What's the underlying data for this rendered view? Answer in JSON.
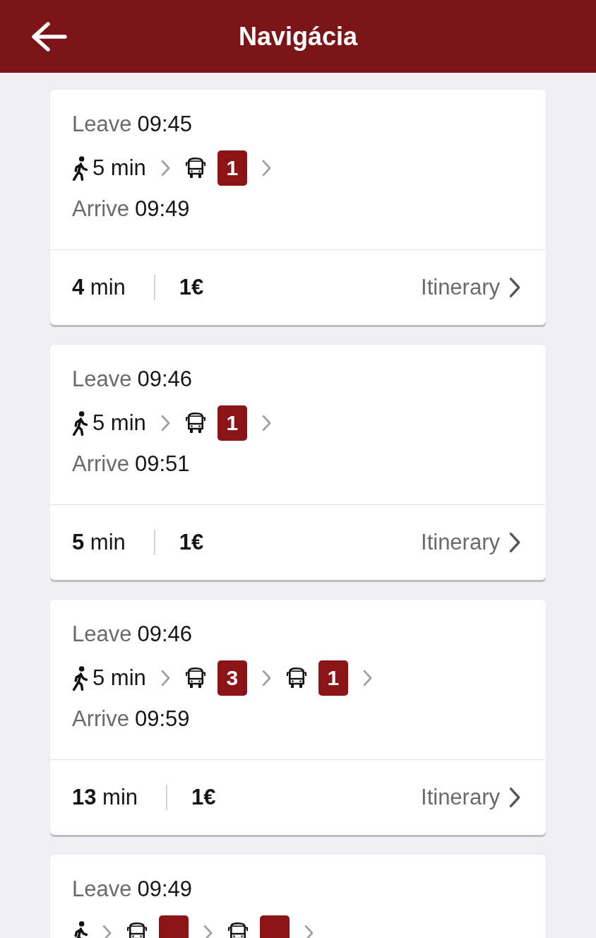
{
  "header": {
    "title": "Navigácia"
  },
  "routes": [
    {
      "leave_label": "Leave",
      "leave_time": "09:45",
      "legs": [
        {
          "kind": "walk",
          "duration": "5 min"
        },
        {
          "kind": "bus",
          "line": "1"
        }
      ],
      "arrive_label": "Arrive",
      "arrive_time": "09:49",
      "total_duration": "**4** min",
      "price": "1€",
      "itinerary_link": "Itinerary"
    },
    {
      "leave_label": "Leave",
      "leave_time": "09:46",
      "legs": [
        {
          "kind": "walk",
          "duration": "5 min"
        },
        {
          "kind": "bus",
          "line": "1"
        }
      ],
      "arrive_label": "Arrive",
      "arrive_time": "09:51",
      "total_duration": "**5** min",
      "price": "1€",
      "itinerary_link": "Itinerary"
    },
    {
      "leave_label": "Leave",
      "leave_time": "09:46",
      "legs": [
        {
          "kind": "walk",
          "duration": "5 min"
        },
        {
          "kind": "bus",
          "line": "3"
        },
        {
          "kind": "bus",
          "line": "1"
        }
      ],
      "arrive_label": "Arrive",
      "arrive_time": "09:59",
      "total_duration": "**13** min",
      "price": "1€",
      "itinerary_link": "Itinerary"
    },
    {
      "leave_label": "Leave",
      "leave_time": "09:49",
      "legs": [
        {
          "kind": "walk"
        },
        {
          "kind": "bus"
        },
        {
          "kind": "bus"
        }
      ]
    }
  ]
}
